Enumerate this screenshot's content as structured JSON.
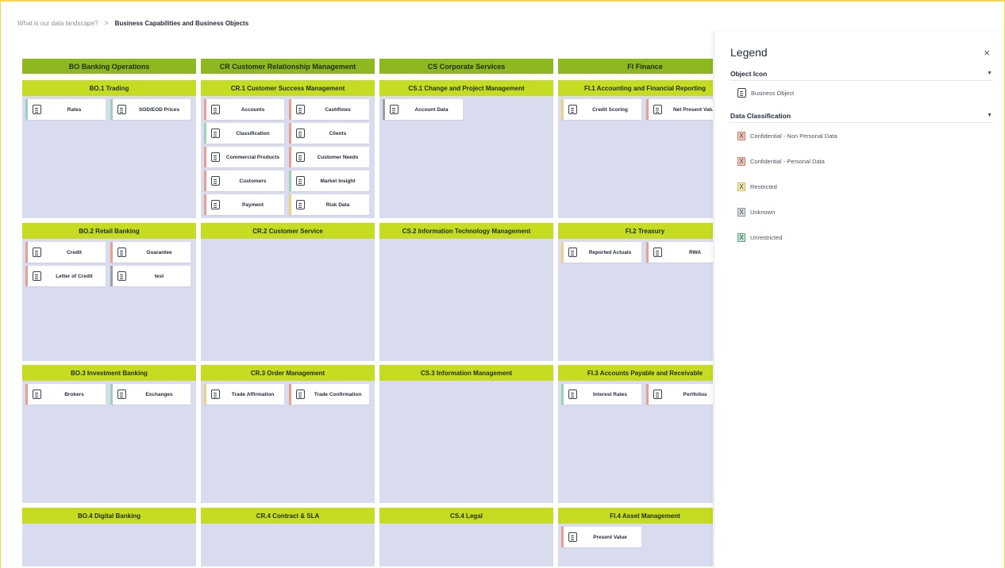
{
  "breadcrumb": {
    "parent": "What is our data landscape?",
    "separator": ">",
    "current": "Business Capabilities and Business Objects"
  },
  "columns": [
    {
      "title": "BO Banking Operations",
      "capabilities": [
        {
          "title": "BO.1 Trading",
          "objects": [
            {
              "label": "Rates",
              "cls": "unrestricted"
            },
            {
              "label": "SOD/EOD Prices",
              "cls": "unrestricted"
            }
          ]
        },
        {
          "title": "BO.2 Retail Banking",
          "objects": [
            {
              "label": "Credit",
              "cls": "personal"
            },
            {
              "label": "Guarantee",
              "cls": "personal"
            },
            {
              "label": "Letter of Credit",
              "cls": "personal"
            },
            {
              "label": "test",
              "cls": "none"
            }
          ]
        },
        {
          "title": "BO.3 Investment Banking",
          "objects": [
            {
              "label": "Brokers",
              "cls": "personal"
            },
            {
              "label": "Exchanges",
              "cls": "unrestricted"
            }
          ]
        },
        {
          "title": "BO.4 Digital Banking",
          "objects": []
        }
      ]
    },
    {
      "title": "CR Customer Relationship Management",
      "capabilities": [
        {
          "title": "CR.1 Customer Success Management",
          "objects": [
            {
              "label": "Accounts",
              "cls": "personal"
            },
            {
              "label": "Cashflows",
              "cls": "personal"
            },
            {
              "label": "Classification",
              "cls": "unrestricted"
            },
            {
              "label": "Clients",
              "cls": "personal"
            },
            {
              "label": "Commercial Products",
              "cls": "nonpersonal"
            },
            {
              "label": "Customer Needs",
              "cls": "personal"
            },
            {
              "label": "Customers",
              "cls": "personal"
            },
            {
              "label": "Market Insight",
              "cls": "unrestricted"
            },
            {
              "label": "Payment",
              "cls": "personal"
            },
            {
              "label": "Risk Data",
              "cls": "restricted"
            }
          ]
        },
        {
          "title": "CR.2 Customer Service",
          "objects": []
        },
        {
          "title": "CR.3 Order Management",
          "objects": [
            {
              "label": "Trade Affirmation",
              "cls": "restricted"
            },
            {
              "label": "Trade Confirmation",
              "cls": "personal"
            }
          ]
        },
        {
          "title": "CR.4 Contract & SLA",
          "objects": []
        }
      ]
    },
    {
      "title": "CS Corporate Services",
      "capabilities": [
        {
          "title": "CS.1 Change and Project Management",
          "objects": [
            {
              "label": "Account Data",
              "cls": "none"
            }
          ]
        },
        {
          "title": "CS.2 Information Technology Management",
          "objects": []
        },
        {
          "title": "CS.3 Information Management",
          "objects": []
        },
        {
          "title": "CS.4 Legal",
          "objects": []
        }
      ]
    },
    {
      "title": "FI Finance",
      "capabilities": [
        {
          "title": "FI.1 Accounting and Financial Reporting",
          "objects": [
            {
              "label": "Credit Scoring",
              "cls": "restricted"
            },
            {
              "label": "Net Present Value",
              "cls": "personal"
            }
          ]
        },
        {
          "title": "FI.2 Treasury",
          "objects": [
            {
              "label": "Reported Actuals",
              "cls": "restricted"
            },
            {
              "label": "RWA",
              "cls": "personal"
            }
          ]
        },
        {
          "title": "FI.3 Accounts Payable and Receivable",
          "objects": [
            {
              "label": "Interest Rates",
              "cls": "unrestricted"
            },
            {
              "label": "Portfolios",
              "cls": "personal"
            }
          ]
        },
        {
          "title": "FI.4 Asset Management",
          "objects": [
            {
              "label": "Present Value",
              "cls": "personal"
            }
          ]
        }
      ]
    }
  ],
  "legend": {
    "title": "Legend",
    "close_glyph": "×",
    "object_icon": {
      "heading": "Object Icon",
      "items": [
        {
          "label": "Business Object",
          "icon": "document-icon"
        }
      ]
    },
    "data_classification": {
      "heading": "Data Classification",
      "items": [
        {
          "label": "Confidential - Non Personal Data",
          "mark": "X",
          "bg": "#f2c2b6",
          "border": "#d9826d"
        },
        {
          "label": "Confidential - Personal Data",
          "mark": "X",
          "bg": "#f2c2b6",
          "border": "#d9826d"
        },
        {
          "label": "Restricted",
          "mark": "X",
          "bg": "#f6e7a8",
          "border": "#d7bd52"
        },
        {
          "label": "Unknown",
          "mark": "X",
          "bg": "#d9dbe0",
          "border": "#8f939b"
        },
        {
          "label": "Unrestricted",
          "mark": "X",
          "bg": "#bfe5cd",
          "border": "#5fae82"
        }
      ]
    }
  }
}
